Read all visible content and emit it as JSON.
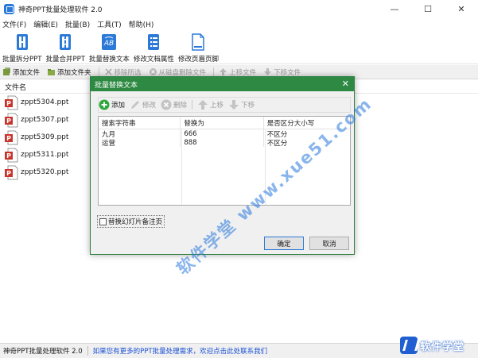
{
  "window": {
    "title": "神奇PPT批量处理软件 2.0",
    "controls": [
      "—",
      "☐",
      "✕"
    ]
  },
  "menu": [
    "文件(F)",
    "编辑(E)",
    "批量(B)",
    "工具(T)",
    "帮助(H)"
  ],
  "toolbar": [
    {
      "label": "批量拆分PPT",
      "icon": "split-ppt-icon"
    },
    {
      "label": "批量合并PPT",
      "icon": "merge-ppt-icon"
    },
    {
      "label": "批量替换文本",
      "icon": "replace-text-icon"
    },
    {
      "label": "修改文档属性",
      "icon": "document-properties-icon"
    },
    {
      "label": "修改页眉页脚",
      "icon": "header-footer-icon"
    }
  ],
  "filebar": {
    "add_file": "添加文件",
    "add_folder": "添加文件夹",
    "remove_selected": "移除所选",
    "delete_from_disk": "从磁盘删除文件",
    "move_up": "上移文件",
    "move_down": "下移文件"
  },
  "file_list": {
    "header": "文件名",
    "files": [
      "zppt5304.ppt",
      "zppt5307.ppt",
      "zppt5309.ppt",
      "zppt5311.ppt",
      "zppt5320.ppt"
    ]
  },
  "dialog": {
    "title": "批量替换文本",
    "close": "✕",
    "toolbar": {
      "add": "添加",
      "edit": "修改",
      "delete": "删除",
      "up": "上移",
      "down": "下移"
    },
    "columns": [
      "搜索字符串",
      "替换为",
      "是否区分大小写"
    ],
    "rows": [
      [
        "九月",
        "666",
        "不区分"
      ],
      [
        "运营",
        "888",
        "不区分"
      ]
    ],
    "checkbox_label": "替换幻灯片备注页",
    "checkbox_checked": false,
    "ok": "确定",
    "cancel": "取消"
  },
  "status": {
    "app_name": "神奇PPT批量处理软件 2.0",
    "link": "如果您有更多的PPT批量处理需求，欢迎点击此处联系我们"
  },
  "watermark": {
    "text1": "软件学堂",
    "text2": "www.xue51.com"
  },
  "corner_logo": "软件学堂",
  "colors": {
    "dialog_title": "#2e8a43",
    "accent_blue": "#2b7ad8",
    "status_link": "#1a4fd6",
    "ppt_red": "#c8342c"
  }
}
